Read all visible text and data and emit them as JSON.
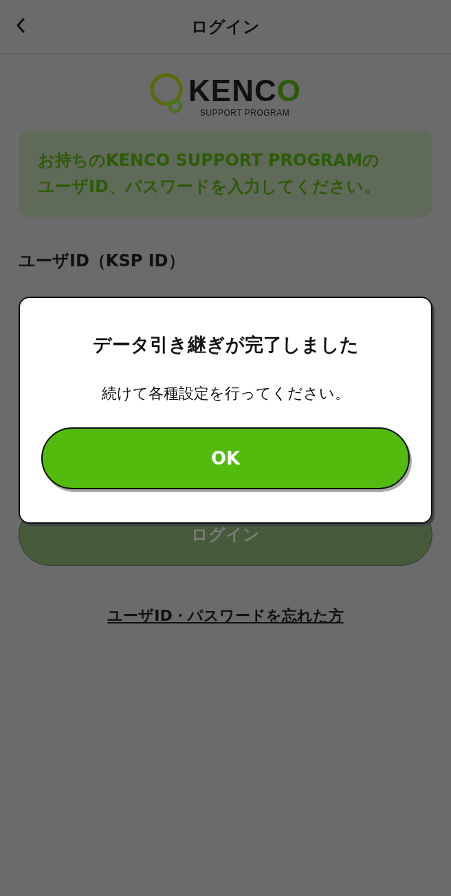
{
  "header": {
    "title": "ログイン"
  },
  "logo": {
    "wordmark": "KENCO",
    "tagline": "SUPPORT PROGRAM"
  },
  "notice": "お持ちのKENCO SUPPORT PROGRAMのユーザID、パスワードを入力してください。",
  "user_id_label": "ユーザID（KSP ID）",
  "login_button": {
    "label": "ログイン",
    "disabled": true
  },
  "forgot_link": "ユーザID・パスワードを忘れた方",
  "dialog": {
    "title": "データ引き継ぎが完了しました",
    "message": "続けて各種設定を行ってください。",
    "button": "OK"
  }
}
